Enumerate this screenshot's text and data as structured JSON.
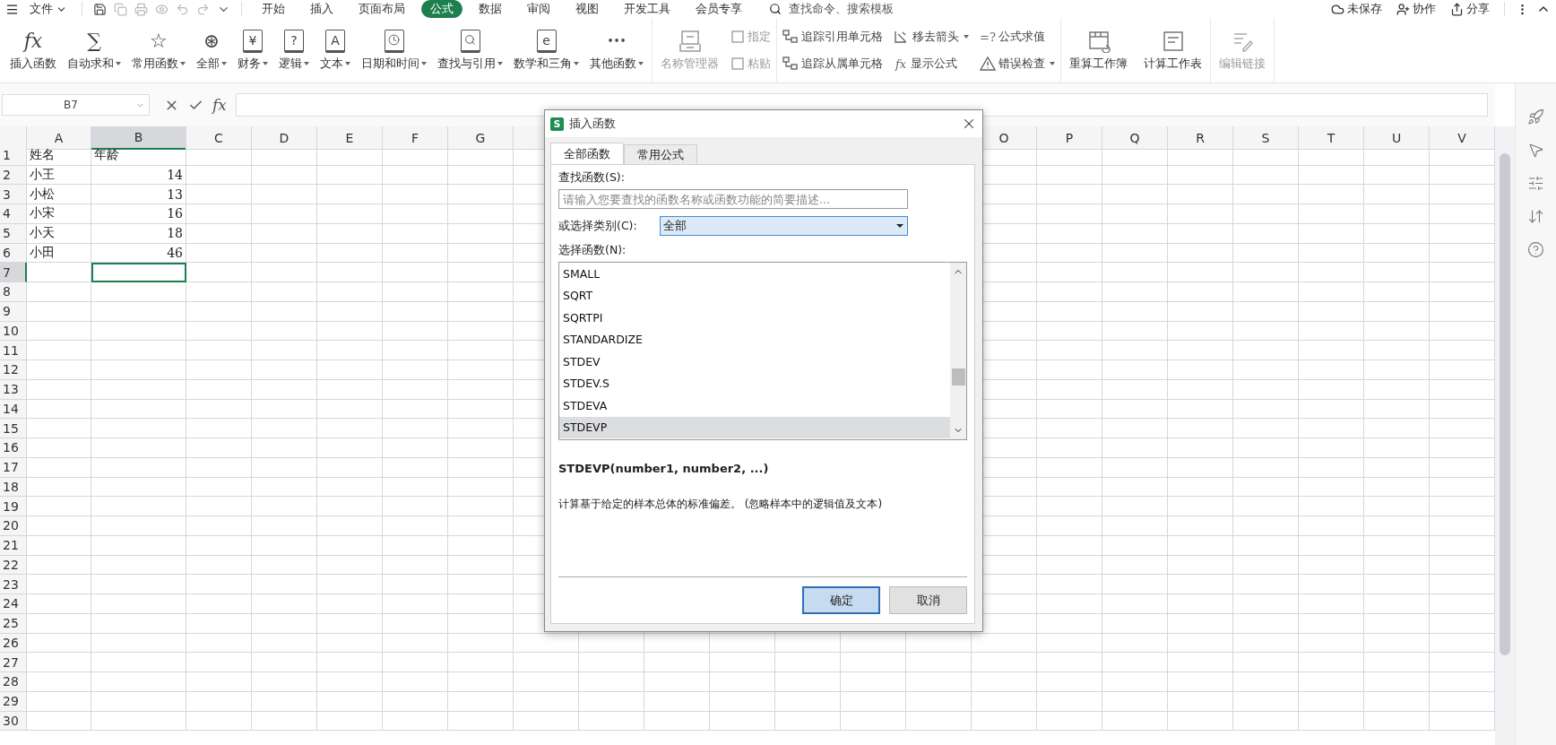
{
  "menu_bar": {
    "file_menu": "文件",
    "tabs": [
      {
        "label": "开始",
        "selected": false
      },
      {
        "label": "插入",
        "selected": false
      },
      {
        "label": "页面布局",
        "selected": false
      },
      {
        "label": "公式",
        "selected": true
      },
      {
        "label": "数据",
        "selected": false
      },
      {
        "label": "审阅",
        "selected": false
      },
      {
        "label": "视图",
        "selected": false
      },
      {
        "label": "开发工具",
        "selected": false
      },
      {
        "label": "会员专享",
        "selected": false
      }
    ],
    "search": {
      "placeholder": "查找命令、搜索模板"
    },
    "actions": [
      {
        "label": "未保存",
        "kind": "cloud"
      },
      {
        "label": "协作",
        "kind": "user"
      },
      {
        "label": "分享",
        "kind": "share"
      }
    ]
  },
  "ribbon": {
    "function_buttons": [
      {
        "label": "插入函数",
        "glyph": "fx",
        "framed": false,
        "dropdown": false
      },
      {
        "label": "自动求和",
        "glyph": "∑",
        "framed": false,
        "dropdown": true
      },
      {
        "label": "常用函数",
        "glyph": "☆",
        "framed": false,
        "dropdown": true
      },
      {
        "label": "全部",
        "glyph": "⊛",
        "framed": false,
        "dropdown": true
      },
      {
        "label": "财务",
        "glyph": "¥",
        "framed": true,
        "dropdown": true
      },
      {
        "label": "逻辑",
        "glyph": "?",
        "framed": true,
        "dropdown": true
      },
      {
        "label": "文本",
        "glyph": "A",
        "framed": true,
        "dropdown": true
      },
      {
        "label": "日期和时间",
        "kind": "clock",
        "framed": true,
        "dropdown": true
      },
      {
        "label": "查找与引用",
        "kind": "search",
        "framed": true,
        "dropdown": true
      },
      {
        "label": "数学和三角",
        "glyph": "e",
        "framed": true,
        "dropdown": true
      },
      {
        "label": "其他函数",
        "glyph": "•••",
        "framed": false,
        "dropdown": true
      }
    ],
    "name_manager": {
      "label": "名称管理器",
      "disabled": true
    },
    "name_actions": [
      {
        "label": "指定",
        "disabled": true
      },
      {
        "label": "粘贴",
        "disabled": true
      }
    ],
    "audit_actions": [
      {
        "label": "追踪引用单元格",
        "kind": "trace",
        "dropdown": false
      },
      {
        "label": "移去箭头",
        "kind": "arrows",
        "dropdown": true
      },
      {
        "label": "公式求值",
        "glyph": "=?",
        "dropdown": false
      },
      {
        "label": "追踪从属单元格",
        "kind": "trace",
        "dropdown": false
      },
      {
        "label": "显示公式",
        "glyph": "fx",
        "dropdown": false
      },
      {
        "label": "错误检查",
        "kind": "warning",
        "dropdown": true
      }
    ],
    "calc_buttons": [
      {
        "label": "重算工作簿",
        "disabled": false
      },
      {
        "label": "计算工作表",
        "disabled": false
      },
      {
        "label": "编辑链接",
        "disabled": true
      }
    ]
  },
  "formula_bar": {
    "name_box": "B7",
    "function_glyph": "fx"
  },
  "sheet": {
    "columns": [
      {
        "label": "A",
        "selected": false
      },
      {
        "label": "B",
        "selected": true
      },
      {
        "label": "C",
        "selected": false
      },
      {
        "label": "D",
        "selected": false
      },
      {
        "label": "E",
        "selected": false
      },
      {
        "label": "F",
        "selected": false
      },
      {
        "label": "G",
        "selected": false
      }
    ],
    "columns_right": [
      {
        "label": "O"
      },
      {
        "label": "P"
      },
      {
        "label": "Q"
      },
      {
        "label": "R"
      },
      {
        "label": "S"
      },
      {
        "label": "T"
      },
      {
        "label": "U"
      },
      {
        "label": "V"
      }
    ],
    "rows": [
      {
        "label": "1",
        "selected": false,
        "cells": [
          {
            "text": "姓名",
            "kind": "text"
          },
          {
            "text": "年龄",
            "kind": "text"
          }
        ]
      },
      {
        "label": "2",
        "selected": false,
        "cells": [
          {
            "text": "小王",
            "kind": "text"
          },
          {
            "text": "14",
            "kind": "number"
          }
        ]
      },
      {
        "label": "3",
        "selected": false,
        "cells": [
          {
            "text": "小松",
            "kind": "text"
          },
          {
            "text": "13",
            "kind": "number"
          }
        ]
      },
      {
        "label": "4",
        "selected": false,
        "cells": [
          {
            "text": "小宋",
            "kind": "text"
          },
          {
            "text": "16",
            "kind": "number"
          }
        ]
      },
      {
        "label": "5",
        "selected": false,
        "cells": [
          {
            "text": "小天",
            "kind": "text"
          },
          {
            "text": "18",
            "kind": "number"
          }
        ]
      },
      {
        "label": "6",
        "selected": false,
        "cells": [
          {
            "text": "小田",
            "kind": "text"
          },
          {
            "text": "46",
            "kind": "number"
          }
        ]
      },
      {
        "label": "7",
        "selected": true
      },
      {
        "label": "8",
        "selected": false
      },
      {
        "label": "9",
        "selected": false
      },
      {
        "label": "10",
        "selected": false
      },
      {
        "label": "11",
        "selected": false
      },
      {
        "label": "12",
        "selected": false
      },
      {
        "label": "13",
        "selected": false
      },
      {
        "label": "14",
        "selected": false
      },
      {
        "label": "15",
        "selected": false
      },
      {
        "label": "16",
        "selected": false
      },
      {
        "label": "17",
        "selected": false
      },
      {
        "label": "18",
        "selected": false
      },
      {
        "label": "19",
        "selected": false
      },
      {
        "label": "20",
        "selected": false
      },
      {
        "label": "21",
        "selected": false
      },
      {
        "label": "22",
        "selected": false
      },
      {
        "label": "23",
        "selected": false
      },
      {
        "label": "24",
        "selected": false
      },
      {
        "label": "25",
        "selected": false
      },
      {
        "label": "26",
        "selected": false
      },
      {
        "label": "27",
        "selected": false
      },
      {
        "label": "28",
        "selected": false
      },
      {
        "label": "29",
        "selected": false
      },
      {
        "label": "30",
        "selected": false
      }
    ]
  },
  "dialog": {
    "title": "插入函数",
    "app_glyph": "S",
    "tabs": [
      {
        "label": "全部函数",
        "selected": true
      },
      {
        "label": "常用公式",
        "selected": false
      }
    ],
    "search_label": "查找函数(S):",
    "search": {
      "placeholder": "请输入您要查找的函数名称或函数功能的简要描述..."
    },
    "category_label": "或选择类别(C):",
    "category": "全部",
    "list_label": "选择函数(N):",
    "functions": [
      {
        "name": "SMALL",
        "selected": false
      },
      {
        "name": "SQRT",
        "selected": false
      },
      {
        "name": "SQRTPI",
        "selected": false
      },
      {
        "name": "STANDARDIZE",
        "selected": false
      },
      {
        "name": "STDEV",
        "selected": false
      },
      {
        "name": "STDEV.S",
        "selected": false
      },
      {
        "name": "STDEVA",
        "selected": false
      },
      {
        "name": "STDEVP",
        "selected": true
      }
    ],
    "signature": "STDEVP(number1, number2, ...)",
    "description": "计算基于给定的样本总体的标准偏差。 (忽略样本中的逻辑值及文本)",
    "buttons": [
      {
        "label": "确定",
        "kind": "primary"
      },
      {
        "label": "取消",
        "kind": "secondary"
      }
    ]
  }
}
